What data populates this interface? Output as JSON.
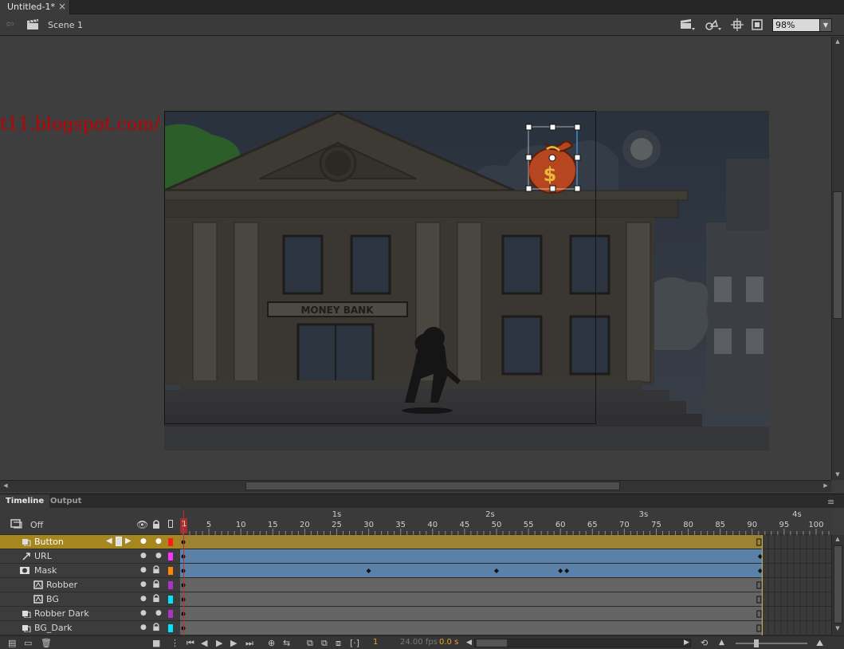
{
  "document": {
    "tab_title": "Untitled-1*",
    "close_glyph": "×"
  },
  "editbar": {
    "back_icon": "back-arrow-icon",
    "scene_label": "Scene 1",
    "zoom": "98%",
    "tools": [
      "edit-scene-icon",
      "edit-symbols-icon",
      "snap-icon",
      "clip-stage-icon"
    ]
  },
  "watermark": "t11.blogspot.com/",
  "stage": {
    "bank_sign": "MONEY BANK",
    "dollar_glyph": "$",
    "colors": {
      "sky": "#2f3744",
      "building": "#3a3631",
      "bag": "#b5461f",
      "tree": "#2f6b2a",
      "selection": "#ffffff"
    }
  },
  "panel": {
    "tabs": [
      "Timeline",
      "Output"
    ],
    "menu_glyph": "≡"
  },
  "timeline": {
    "header_label": "Off",
    "seconds": [
      "1s",
      "2s",
      "3s",
      "4s"
    ],
    "frame_numbers": [
      "1",
      "5",
      "10",
      "15",
      "20",
      "25",
      "30",
      "35",
      "40",
      "45",
      "50",
      "55",
      "60",
      "65",
      "70",
      "75",
      "80",
      "85",
      "90",
      "95",
      "100"
    ],
    "layers": [
      {
        "name": "Button",
        "selected": true,
        "color": "#ff1a1a",
        "indent": 0,
        "type": "layer"
      },
      {
        "name": "URL",
        "selected": false,
        "color": "#ff33ff",
        "indent": 0,
        "type": "guide"
      },
      {
        "name": "Mask",
        "selected": false,
        "color": "#ff8800",
        "indent": 0,
        "type": "mask",
        "keyframes": [
          30,
          50,
          60,
          61
        ]
      },
      {
        "name": "Robber",
        "selected": false,
        "color": "#aa33cc",
        "indent": 1,
        "type": "masked"
      },
      {
        "name": "BG",
        "selected": false,
        "color": "#00e5ff",
        "indent": 1,
        "type": "masked"
      },
      {
        "name": "Robber Dark",
        "selected": false,
        "color": "#aa33cc",
        "indent": 0,
        "type": "layer"
      },
      {
        "name": "BG_Dark",
        "selected": false,
        "color": "#00e5ff",
        "indent": 0,
        "type": "layer"
      }
    ],
    "current_frame": "1",
    "fps": "24.00 fps",
    "elapsed": "0.0 s",
    "colors": {
      "tween_blue": "#5c81a8",
      "selected_row": "#a5861f",
      "playhead": "#c12e2e"
    }
  }
}
